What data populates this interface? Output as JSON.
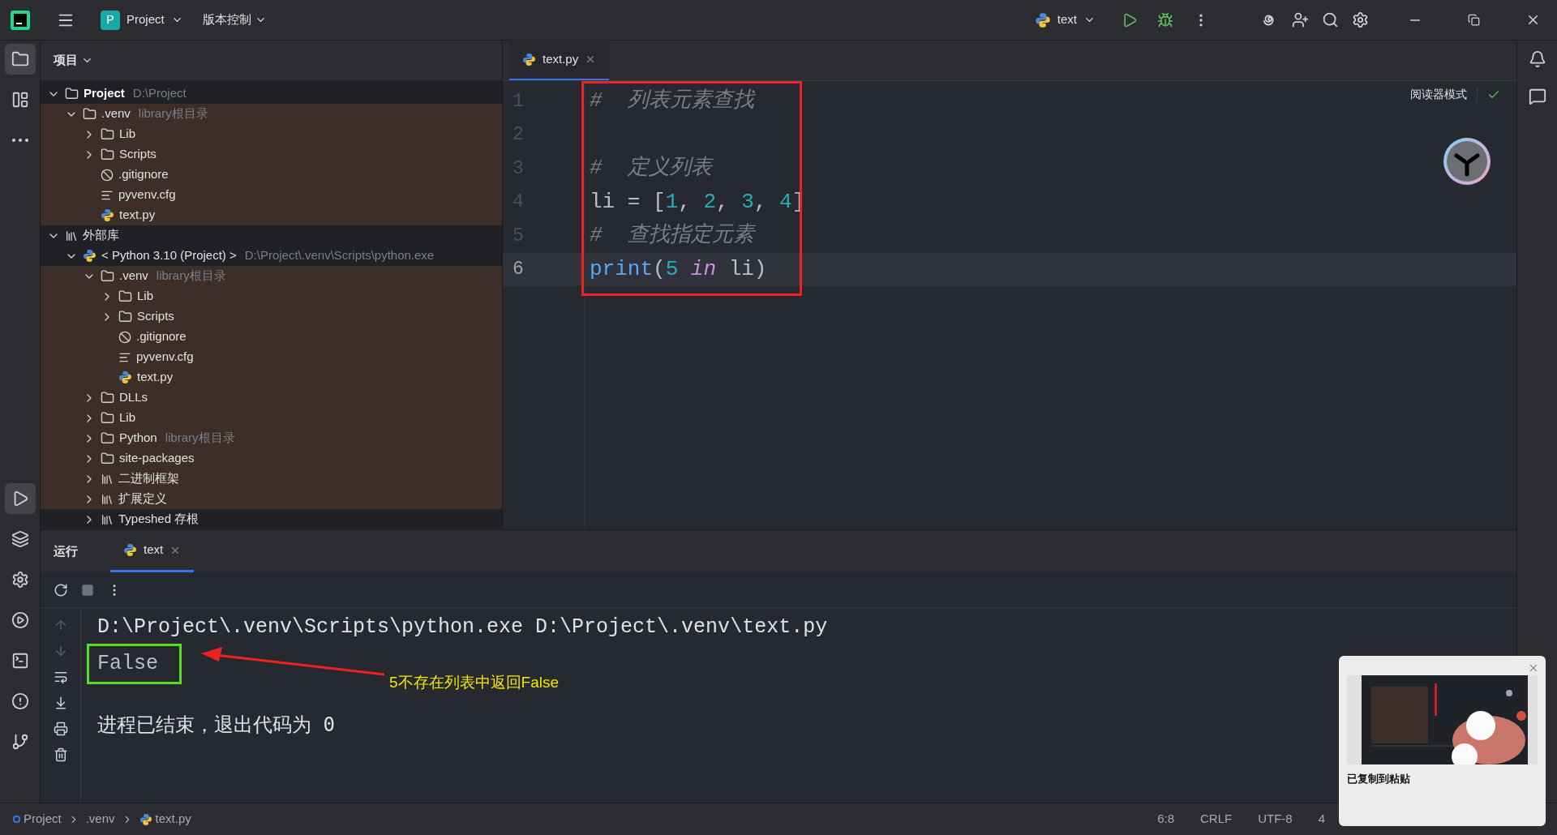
{
  "title_bar": {
    "project": {
      "letter": "P",
      "label": "Project"
    },
    "vcs": "版本控制",
    "run_config": "text"
  },
  "project_panel": {
    "title": "项目",
    "tree": [
      {
        "label": "Project",
        "hint": "D:\\Project",
        "kind": "folder",
        "expanded": true,
        "tinted": false,
        "bold": true,
        "children": [
          {
            "label": ".venv",
            "hint": "library根目录",
            "kind": "folder",
            "expanded": true,
            "tinted": true,
            "children": [
              {
                "label": "Lib",
                "kind": "folder",
                "expanded": false,
                "tinted": true
              },
              {
                "label": "Scripts",
                "kind": "folder",
                "expanded": false,
                "tinted": true
              },
              {
                "label": ".gitignore",
                "kind": "ignore",
                "tinted": true
              },
              {
                "label": "pyvenv.cfg",
                "kind": "config",
                "tinted": true
              },
              {
                "label": "text.py",
                "kind": "python",
                "tinted": true
              }
            ]
          }
        ]
      },
      {
        "label": "外部库",
        "kind": "library",
        "expanded": true,
        "tinted": false,
        "children": [
          {
            "label": "< Python 3.10 (Project) >",
            "hint": "D:\\Project\\.venv\\Scripts\\python.exe",
            "kind": "python",
            "expanded": true,
            "tinted": false,
            "children": [
              {
                "label": ".venv",
                "hint": "library根目录",
                "kind": "folder",
                "expanded": true,
                "tinted": true,
                "children": [
                  {
                    "label": "Lib",
                    "kind": "folder",
                    "expanded": false,
                    "tinted": true
                  },
                  {
                    "label": "Scripts",
                    "kind": "folder",
                    "expanded": false,
                    "tinted": true
                  },
                  {
                    "label": ".gitignore",
                    "kind": "ignore",
                    "tinted": true
                  },
                  {
                    "label": "pyvenv.cfg",
                    "kind": "config",
                    "tinted": true
                  },
                  {
                    "label": "text.py",
                    "kind": "python",
                    "tinted": true
                  }
                ]
              },
              {
                "label": "DLLs",
                "kind": "folder",
                "expanded": false,
                "tinted": true
              },
              {
                "label": "Lib",
                "kind": "folder",
                "expanded": false,
                "tinted": true
              },
              {
                "label": "Python",
                "hint": "library根目录",
                "kind": "folder",
                "expanded": false,
                "tinted": true
              },
              {
                "label": "site-packages",
                "kind": "folder",
                "expanded": false,
                "tinted": true
              },
              {
                "label": "二进制框架",
                "kind": "library",
                "expanded": false,
                "tinted": true
              },
              {
                "label": "扩展定义",
                "kind": "library",
                "expanded": false,
                "tinted": true
              },
              {
                "label": "Typeshed 存根",
                "kind": "library",
                "expanded": false,
                "tinted": false
              }
            ]
          }
        ]
      }
    ]
  },
  "editor": {
    "tabs": [
      {
        "label": "text.py",
        "selected": true
      }
    ],
    "reader_mode": "阅读器模式",
    "lines": [
      {
        "number": "1",
        "current": false,
        "tokens": [
          {
            "kind": "comment",
            "text": "#  列表元素查找"
          }
        ]
      },
      {
        "number": "2",
        "current": false
      },
      {
        "number": "3",
        "current": false,
        "tokens": [
          {
            "kind": "comment",
            "text": "#  定义列表"
          }
        ]
      },
      {
        "number": "4",
        "current": false,
        "tokens": [
          {
            "kind": "plain",
            "text": "li = ["
          },
          {
            "kind": "number",
            "text": "1"
          },
          {
            "kind": "plain",
            "text": ", "
          },
          {
            "kind": "number",
            "text": "2"
          },
          {
            "kind": "plain",
            "text": ", "
          },
          {
            "kind": "number",
            "text": "3"
          },
          {
            "kind": "plain",
            "text": ", "
          },
          {
            "kind": "number",
            "text": "4"
          },
          {
            "kind": "plain",
            "text": "]"
          }
        ]
      },
      {
        "number": "5",
        "current": false,
        "tokens": [
          {
            "kind": "comment",
            "text": "#  查找指定元素"
          }
        ]
      },
      {
        "number": "6",
        "current": true,
        "tokens": [
          {
            "kind": "builtin",
            "text": "print"
          },
          {
            "kind": "plain",
            "text": "("
          },
          {
            "kind": "number",
            "text": "5"
          },
          {
            "kind": "keyword",
            "text": " in"
          },
          {
            "kind": "plain",
            "text": " li)"
          }
        ]
      }
    ]
  },
  "run_panel": {
    "title": "运行",
    "tabs": [
      {
        "label": "text",
        "selected": true
      }
    ],
    "output": [
      {
        "kind": "command",
        "text": "D:\\Project\\.venv\\Scripts\\python.exe D:\\Project\\.venv\\text.py"
      },
      {
        "kind": "result",
        "text": "False"
      },
      {
        "kind": "blank"
      },
      {
        "kind": "exit",
        "text": "进程已结束，退出代码为 0"
      }
    ],
    "annotation": "5不存在列表中返回False"
  },
  "status_bar": {
    "breadcrumbs": [
      {
        "label": "Project",
        "kind": "project"
      },
      {
        "label": ".venv",
        "kind": "folder"
      },
      {
        "label": "text.py",
        "kind": "python"
      }
    ],
    "items": [
      "6:8",
      "CRLF",
      "UTF-8",
      "4"
    ]
  },
  "notification": {
    "title": "已复制到粘贴"
  }
}
